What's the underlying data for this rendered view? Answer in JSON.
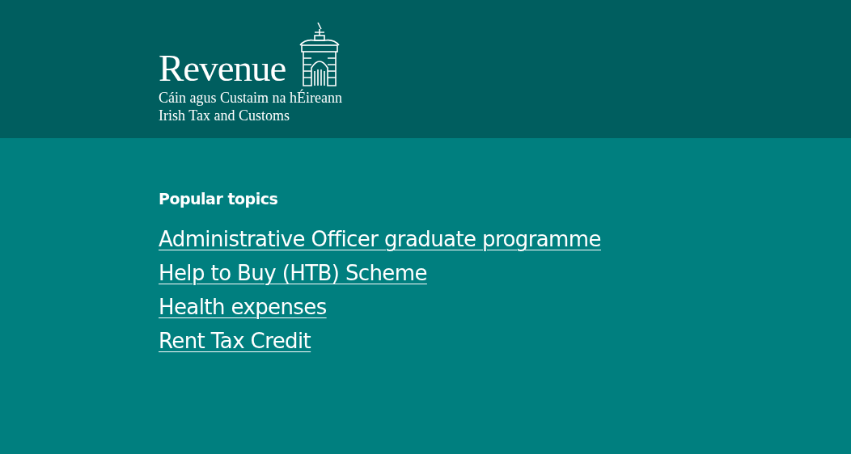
{
  "header": {
    "logo": {
      "name": "Revenue",
      "tagline_irish": "Cáin agus Custaim na hÉireann",
      "tagline_english": "Irish Tax and Customs"
    }
  },
  "popular_topics": {
    "heading": "Popular topics",
    "links": [
      {
        "label": "Administrative Officer graduate programme"
      },
      {
        "label": "Help to Buy (HTB) Scheme"
      },
      {
        "label": "Health expenses"
      },
      {
        "label": "Rent Tax Credit"
      }
    ]
  }
}
